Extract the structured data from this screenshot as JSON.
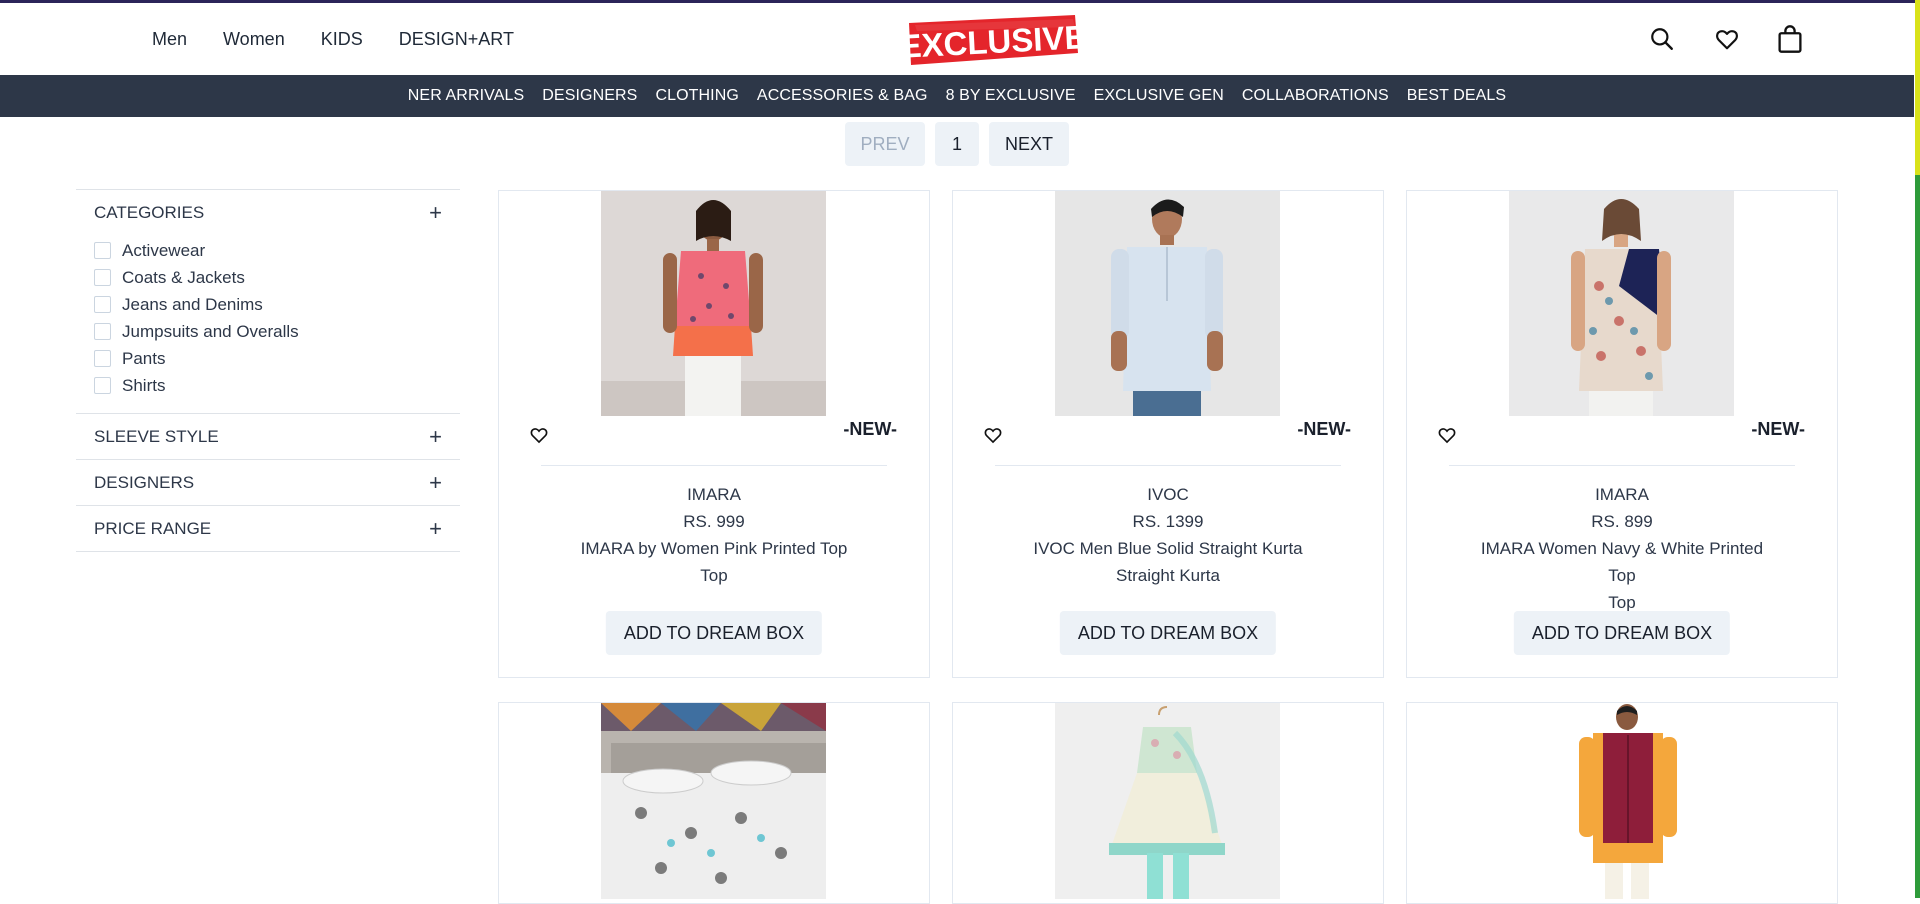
{
  "header": {
    "nav": [
      "Men",
      "Women",
      "KIDS",
      "DESIGN+ART"
    ],
    "logo_text": "EXCLUSIVE"
  },
  "category_bar": [
    "NER ARRIVALS",
    "DESIGNERS",
    "CLOTHING",
    "ACCESSORIES & BAG",
    "8 BY EXCLUSIVE",
    "EXCLUSIVE GEN",
    "COLLABORATIONS",
    "BEST DEALS"
  ],
  "pagination": {
    "prev": "PREV",
    "page": "1",
    "next": "NEXT"
  },
  "filters": {
    "categories_title": "CATEGORIES",
    "categories": [
      "Activewear",
      "Coats & Jackets",
      "Jeans and Denims",
      "Jumpsuits and Overalls",
      "Pants",
      "Shirts"
    ],
    "sleeve_title": "SLEEVE STYLE",
    "designers_title": "DESIGNERS",
    "price_title": "PRICE RANGE",
    "toggle": "+"
  },
  "products": [
    {
      "badge": "-NEW-",
      "brand": "IMARA",
      "price": "RS. 999",
      "name": "IMARA by Women Pink Printed Top",
      "sub": "Top",
      "cta": "ADD TO DREAM BOX"
    },
    {
      "badge": "-NEW-",
      "brand": "IVOC",
      "price": "RS. 1399",
      "name": "IVOC Men Blue Solid Straight Kurta",
      "sub": "Straight Kurta",
      "cta": "ADD TO DREAM BOX"
    },
    {
      "badge": "-NEW-",
      "brand": "IMARA",
      "price": "RS. 899",
      "name": "IMARA Women Navy & White Printed Top",
      "sub": "Top",
      "cta": "ADD TO DREAM BOX"
    }
  ],
  "colors": {
    "navbar": "#2d3748",
    "logo_red": "#e4252b",
    "button_bg": "#edf2f7"
  }
}
